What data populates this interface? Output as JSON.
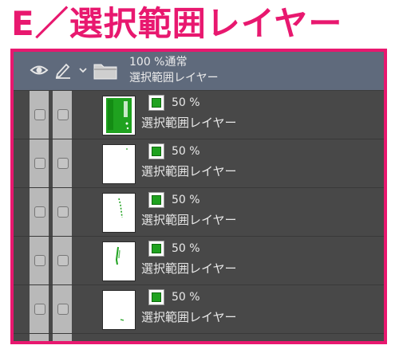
{
  "heading": "E／選択範囲レイヤー",
  "folder": {
    "opacity_blend": "100 %通常",
    "name": "選択範囲レイヤー"
  },
  "layers": [
    {
      "opacity": "50 %",
      "name": "選択範囲レイヤー"
    },
    {
      "opacity": "50 %",
      "name": "選択範囲レイヤー"
    },
    {
      "opacity": "50 %",
      "name": "選択範囲レイヤー"
    },
    {
      "opacity": "50 %",
      "name": "選択範囲レイヤー"
    },
    {
      "opacity": "50 %",
      "name": "選択範囲レイヤー"
    }
  ],
  "colors": {
    "accent": "#e8186f",
    "selection_green": "#1fa21f",
    "panel_bg": "#484848",
    "folder_row_bg": "#5f6a7c"
  }
}
